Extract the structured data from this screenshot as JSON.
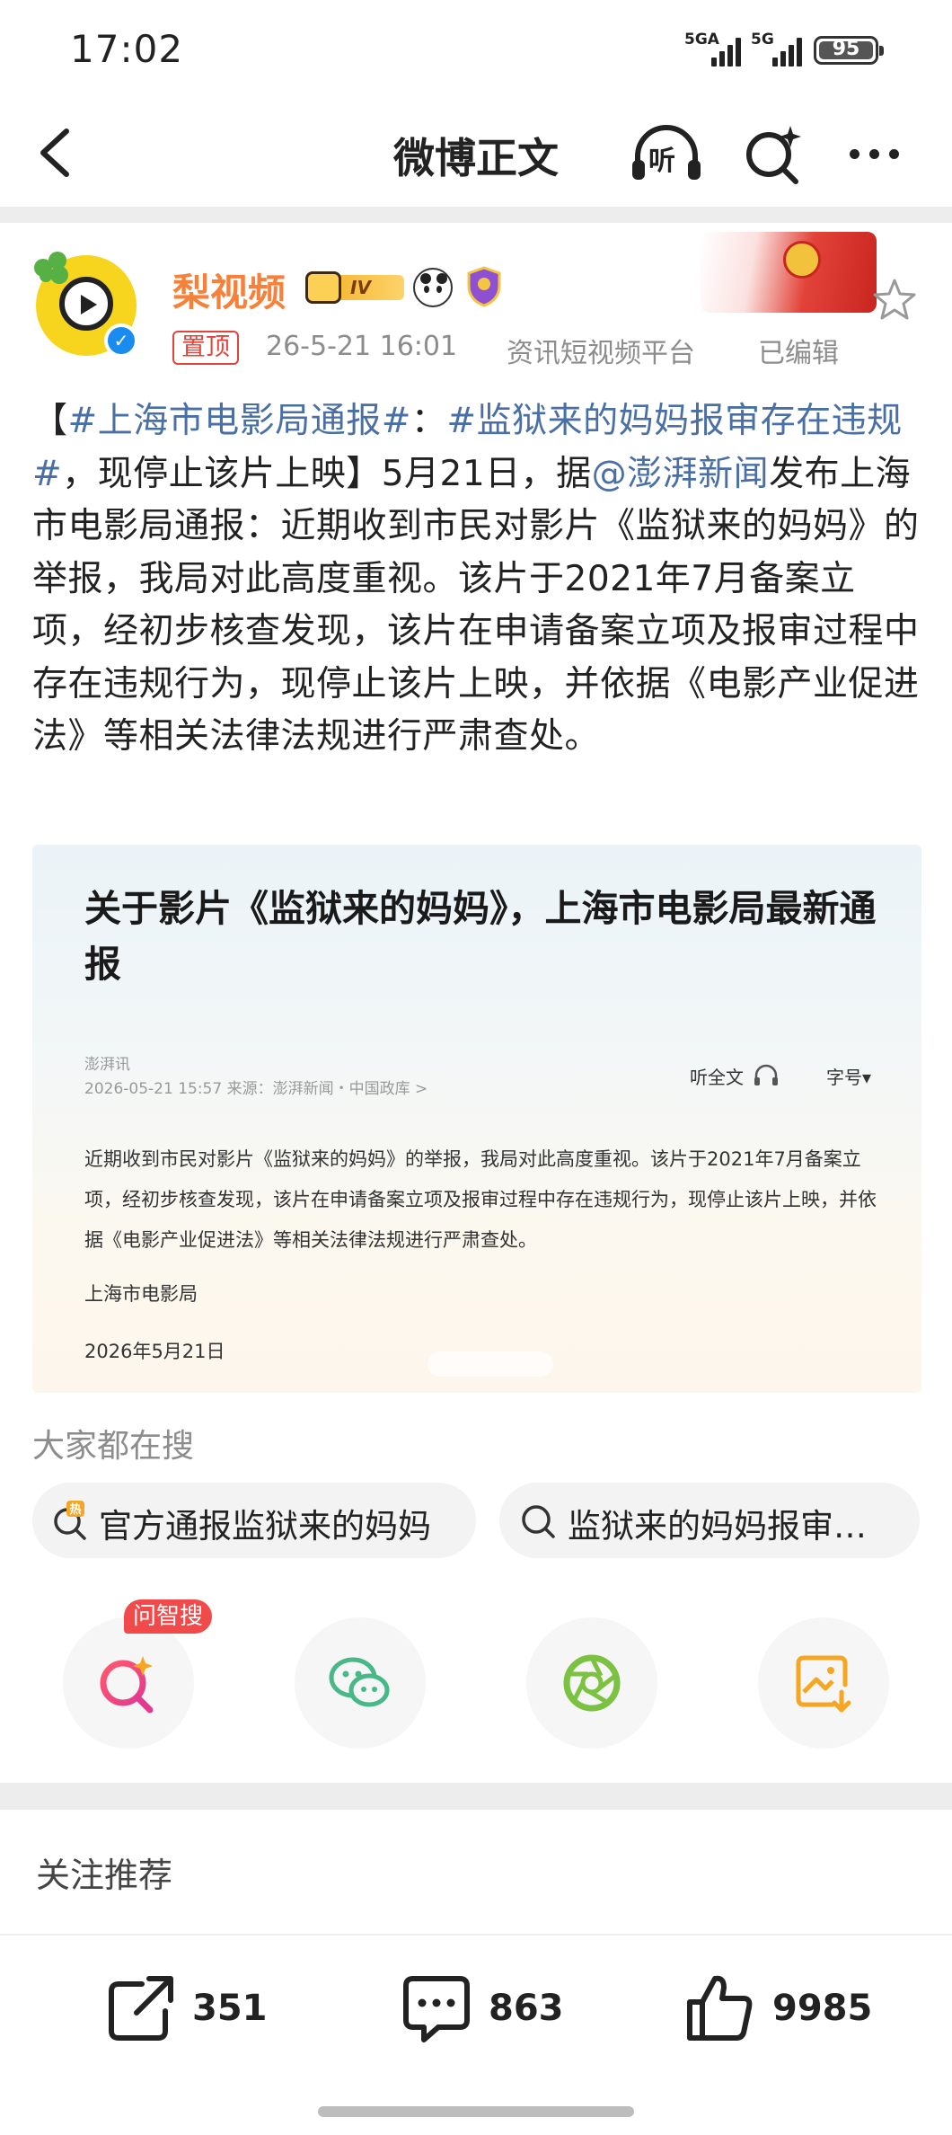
{
  "status_bar": {
    "time": "17:02",
    "signal1_label": "5GA",
    "signal2_label": "5G",
    "battery": "95"
  },
  "nav": {
    "title": "微博正文",
    "listen_label": "听"
  },
  "post": {
    "username": "梨视频",
    "vip_level": "IV",
    "pin_label": "置顶",
    "time": "26-5-21 16:01",
    "source": "资讯短视频平台",
    "edited": "已编辑",
    "text": {
      "open_bracket": "【",
      "hashtag1": "#上海市电影局通报#",
      "colon": "：",
      "hashtag2": "#监狱来的妈妈报审存在违规#",
      "after_hashtags": "，现停止该片上映】5月21日，据",
      "mention": "@澎湃新闻",
      "body": "发布上海市电影局通报：近期收到市民对影片《监狱来的妈妈》的举报，我局对此高度重视。该片于2021年7月备案立项，经初步核查发现，该片在申请备案立项及报审过程中存在违规行为，现停止该片上映，并依据《电影产业促进法》等相关法律法规进行严肃查处。"
    }
  },
  "embed": {
    "title": "关于影片《监狱来的妈妈》，上海市电影局最新通报",
    "source_name": "澎湃讯",
    "date_line": "2026-05-21 15:57  来源：澎湃新闻・中国政库 >",
    "listen_label": "听全文",
    "font_label": "字号▾",
    "body": "近期收到市民对影片《监狱来的妈妈》的举报，我局对此高度重视。该片于2021年7月备案立项，经初步核查发现，该片在申请备案立项及报审过程中存在违规行为，现停止该片上映，并依据《电影产业促进法》等相关法律法规进行严肃查处。",
    "signature": "上海市电影局",
    "sign_date": "2026年5月21日"
  },
  "search": {
    "heading": "大家都在搜",
    "chips": [
      {
        "label": "官方通报监狱来的妈妈",
        "icon": "hot-search-icon"
      },
      {
        "label": "监狱来的妈妈报审…",
        "icon": "search-icon"
      }
    ]
  },
  "share": {
    "ai_badge": "问智搜",
    "items": [
      "ai-search-icon",
      "wechat-icon",
      "moments-icon",
      "save-image-icon"
    ]
  },
  "follow": {
    "heading": "关注推荐"
  },
  "actions": {
    "repost_count": "351",
    "comment_count": "863",
    "like_count": "9985"
  },
  "colors": {
    "username": "#f6813b",
    "link": "#4a6fa5",
    "pin": "#e0443b",
    "meta": "#8c8c8c",
    "badge": "#f04a4a"
  }
}
